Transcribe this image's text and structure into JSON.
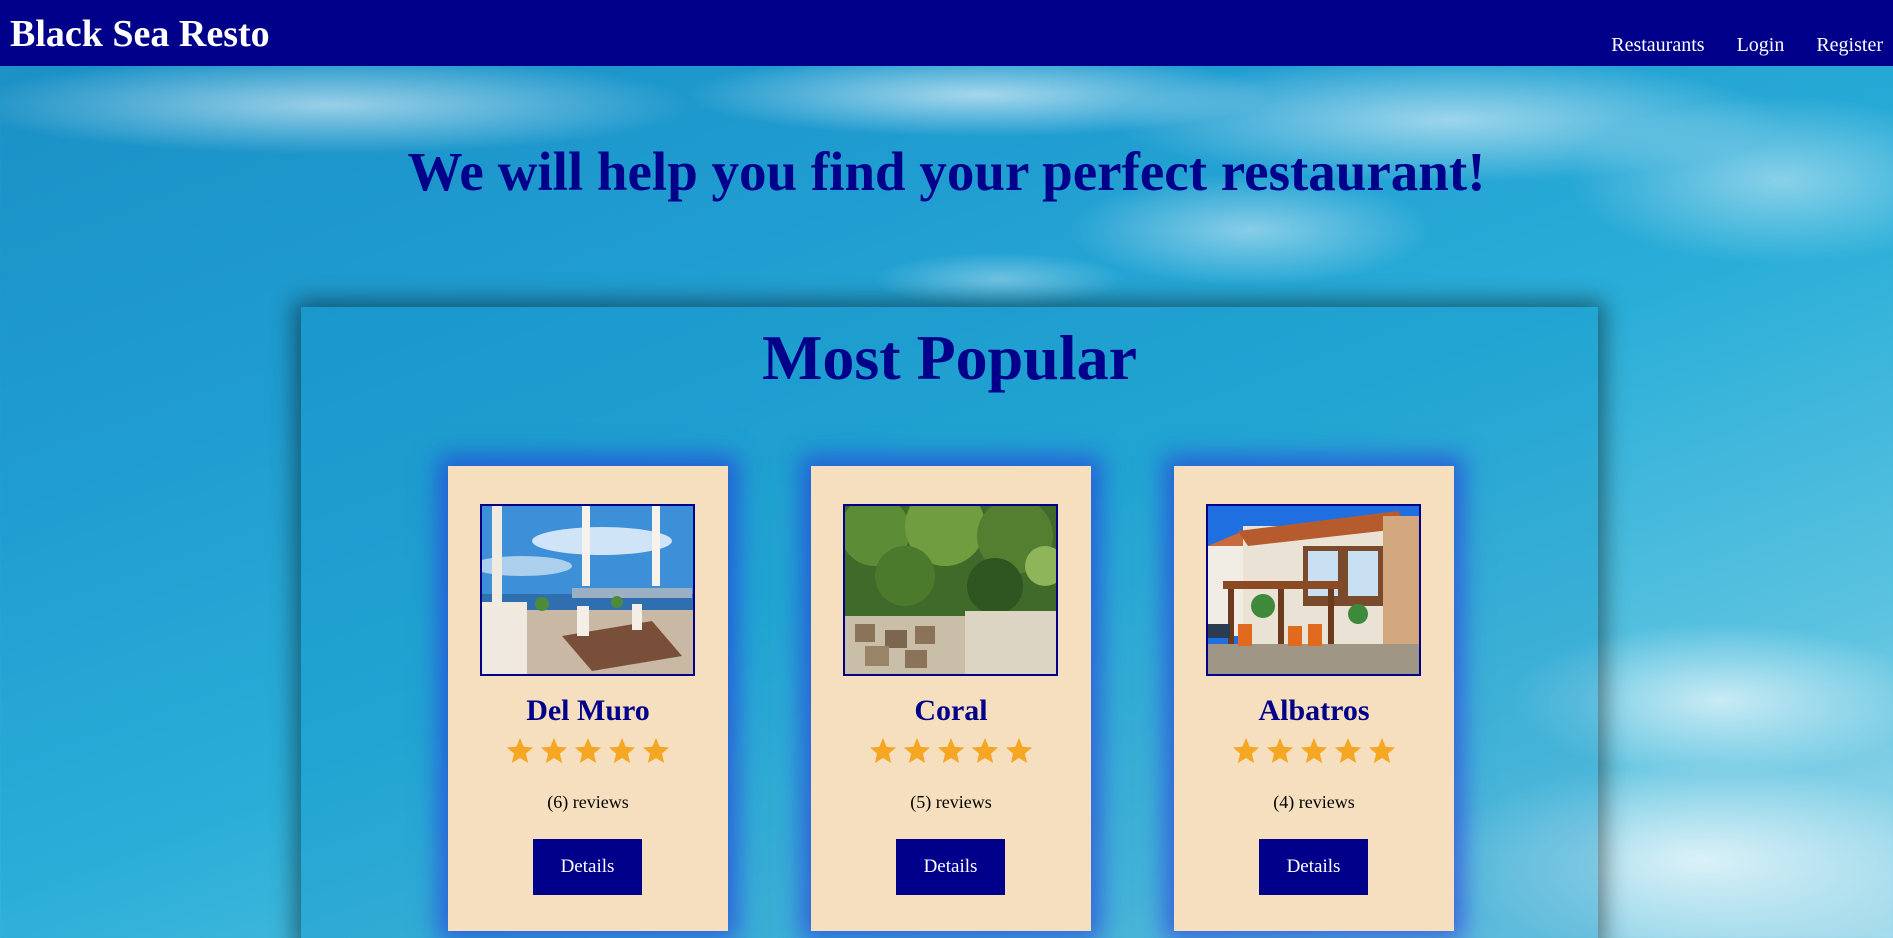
{
  "header": {
    "brand": "Black Sea Resto",
    "nav": [
      "Restaurants",
      "Login",
      "Register"
    ]
  },
  "hero": {
    "title": "We will help you find your perfect restaurant!"
  },
  "popular": {
    "title": "Most Popular",
    "restaurants": [
      {
        "name": "Del Muro",
        "rating": 5,
        "reviews": "(6) reviews",
        "button": "Details"
      },
      {
        "name": "Coral",
        "rating": 5,
        "reviews": "(5) reviews",
        "button": "Details"
      },
      {
        "name": "Albatros",
        "rating": 5,
        "reviews": "(4) reviews",
        "button": "Details"
      }
    ]
  },
  "colors": {
    "navbar": "#00008b",
    "title_text": "#00008b",
    "card_background": "#f6dfbf",
    "star": "#f5a623",
    "button": "#00008b"
  },
  "icons": [
    "star-icon"
  ]
}
